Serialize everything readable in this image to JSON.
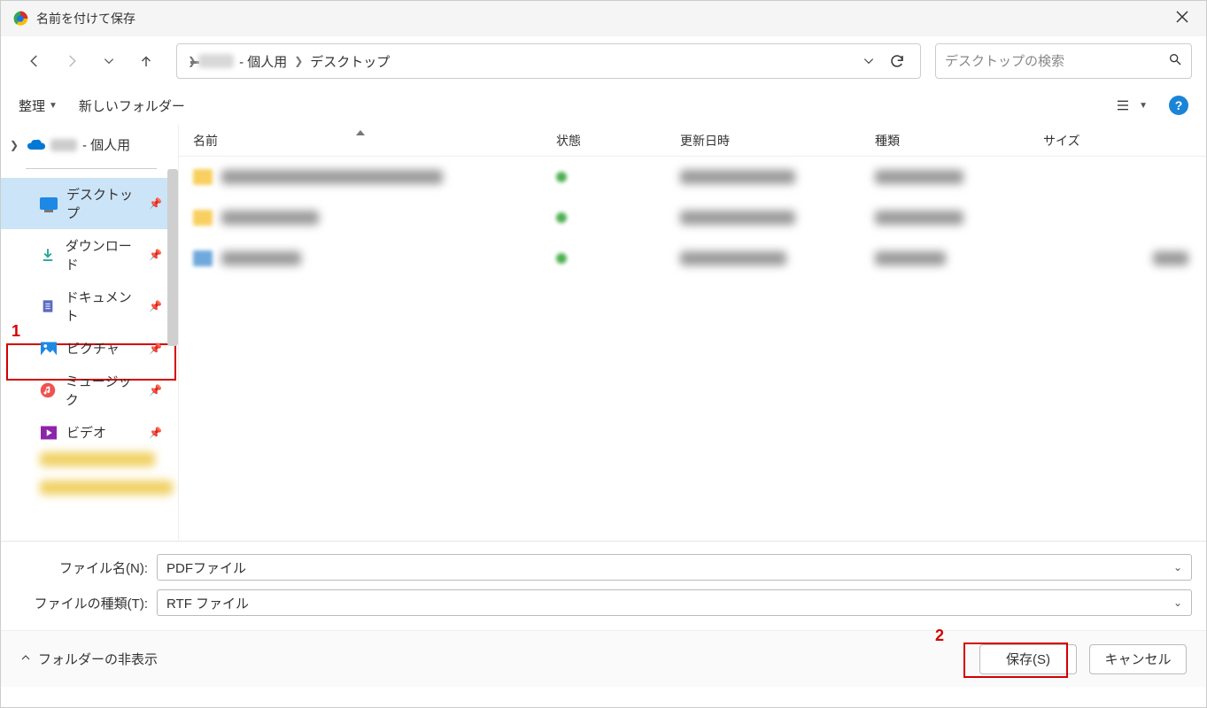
{
  "window": {
    "title": "名前を付けて保存"
  },
  "nav": {
    "back": "←",
    "forward": "→",
    "recent": "˅",
    "up": "↑"
  },
  "breadcrumb": {
    "part1_suffix": " - 個人用",
    "part2": "デスクトップ"
  },
  "sidebar_onedrive_suffix": " - 個人用",
  "search": {
    "placeholder": "デスクトップの検索"
  },
  "toolbar": {
    "organize": "整理",
    "new_folder": "新しいフォルダー"
  },
  "columns": {
    "name": "名前",
    "state": "状態",
    "date": "更新日時",
    "type": "種類",
    "size": "サイズ"
  },
  "favorites": {
    "desktop": "デスクトップ",
    "downloads": "ダウンロード",
    "documents": "ドキュメント",
    "pictures": "ピクチャ",
    "music": "ミュージック",
    "videos": "ビデオ"
  },
  "fields": {
    "filename_label": "ファイル名(N):",
    "filename_value": "PDFファイル",
    "filetype_label": "ファイルの種類(T):",
    "filetype_value": "RTF ファイル"
  },
  "footer": {
    "hide_folders": "フォルダーの非表示",
    "save": "保存(S)",
    "cancel": "キャンセル"
  },
  "annotations": {
    "one": "1",
    "two": "2"
  }
}
